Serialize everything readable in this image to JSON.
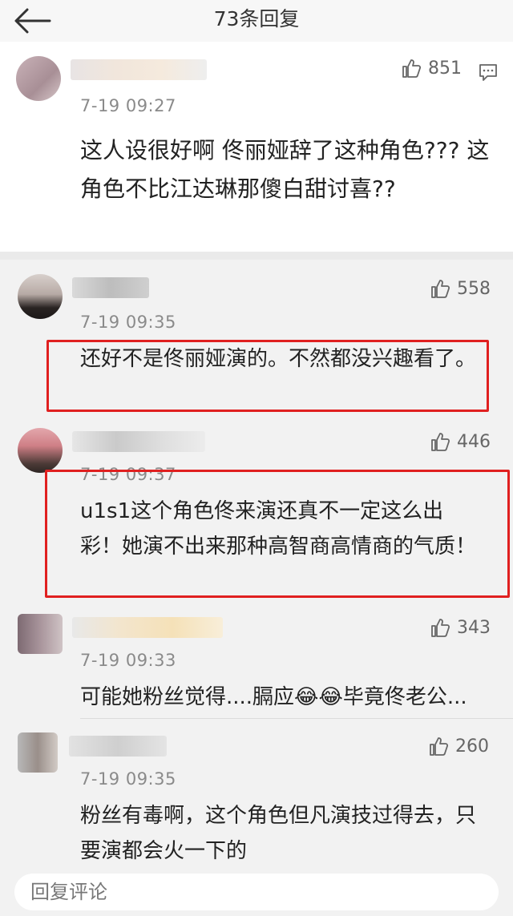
{
  "header": {
    "title": "73条回复"
  },
  "main_comment": {
    "time": "7-19 09:27",
    "likes": "851",
    "content": "这人设很好啊 佟丽娅辞了这种角色??? 这角色不比江达琳那傻白甜讨喜??"
  },
  "replies": [
    {
      "time": "7-19 09:35",
      "likes": "558",
      "content": "还好不是佟丽娅演的。不然都没兴趣看了。",
      "highlighted": true
    },
    {
      "time": "7-19 09:37",
      "likes": "446",
      "content": "u1s1这个角色佟来演还真不一定这么出彩！她演不出来那种高智商高情商的气质！",
      "highlighted": true
    },
    {
      "time": "7-19 09:33",
      "likes": "343",
      "content": "可能她粉丝觉得....膈应😂😂毕竟佟老公...",
      "highlighted": false
    },
    {
      "time": "7-19 09:35",
      "likes": "260",
      "content": "粉丝有毒啊，这个角色但凡演技过得去，只要演都会火一下的",
      "highlighted": false
    }
  ],
  "bottom": {
    "reply_placeholder": "回复评论"
  },
  "colors": {
    "highlight": "#e02020",
    "background": "#f2f2f2"
  }
}
